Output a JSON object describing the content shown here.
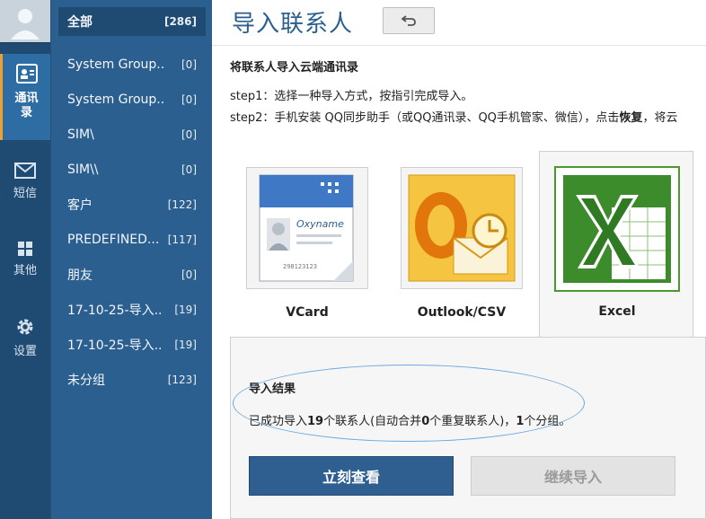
{
  "nav": {
    "items": [
      {
        "label": "通讯录",
        "icon": "contacts-icon",
        "active": true
      },
      {
        "label": "短信",
        "icon": "envelope-icon",
        "active": false
      },
      {
        "label": "其他",
        "icon": "grid-icon",
        "active": false
      },
      {
        "label": "设置",
        "icon": "gear-icon",
        "active": false
      }
    ]
  },
  "groups": [
    {
      "name": "全部",
      "count": "[286]",
      "active": true
    },
    {
      "name": "System Group..",
      "count": "[0]"
    },
    {
      "name": "System Group..",
      "count": "[0]"
    },
    {
      "name": "SIM\\",
      "count": "[0]"
    },
    {
      "name": "SIM\\\\",
      "count": "[0]"
    },
    {
      "name": "客户",
      "count": "[122]"
    },
    {
      "name": "PREDEFINED...",
      "count": "[117]"
    },
    {
      "name": "朋友",
      "count": "[0]"
    },
    {
      "name": "17-10-25-导入..",
      "count": "[19]"
    },
    {
      "name": "17-10-25-导入..",
      "count": "[19]"
    },
    {
      "name": "未分组",
      "count": "[123]"
    }
  ],
  "main": {
    "title": "导入联系人",
    "back_icon": "undo-icon",
    "subtitle": "将联系人导入云端通讯录",
    "step1": "step1：选择一种导入方式，按指引完成导入。",
    "step2_pre": "step2：手机安装 QQ同步助手（或QQ通讯录、QQ手机管家、微信），点击",
    "step2_bold": "恢复",
    "step2_post": "，将云"
  },
  "formats": [
    {
      "label": "VCard",
      "icon": "vcard-icon",
      "card_text": "Oxyname",
      "card_number": "298123123"
    },
    {
      "label": "Outlook/CSV",
      "icon": "outlook-icon"
    },
    {
      "label": "Excel",
      "icon": "excel-icon",
      "selected": true
    }
  ],
  "result": {
    "title": "导入结果",
    "msg_part1": "已成功导入",
    "msg_num1": "19",
    "msg_part2": "个联系人(自动合并",
    "msg_num2": "0",
    "msg_part3": "个重复联系人)，",
    "msg_num3": "1",
    "msg_part4": "个分组。",
    "view_button": "立刻查看",
    "continue_button": "继续导入"
  },
  "colors": {
    "nav_bg": "#1f4a72",
    "group_bg": "#2b5f8f",
    "accent": "#2f5f90",
    "annotation": "#6aa8df"
  }
}
